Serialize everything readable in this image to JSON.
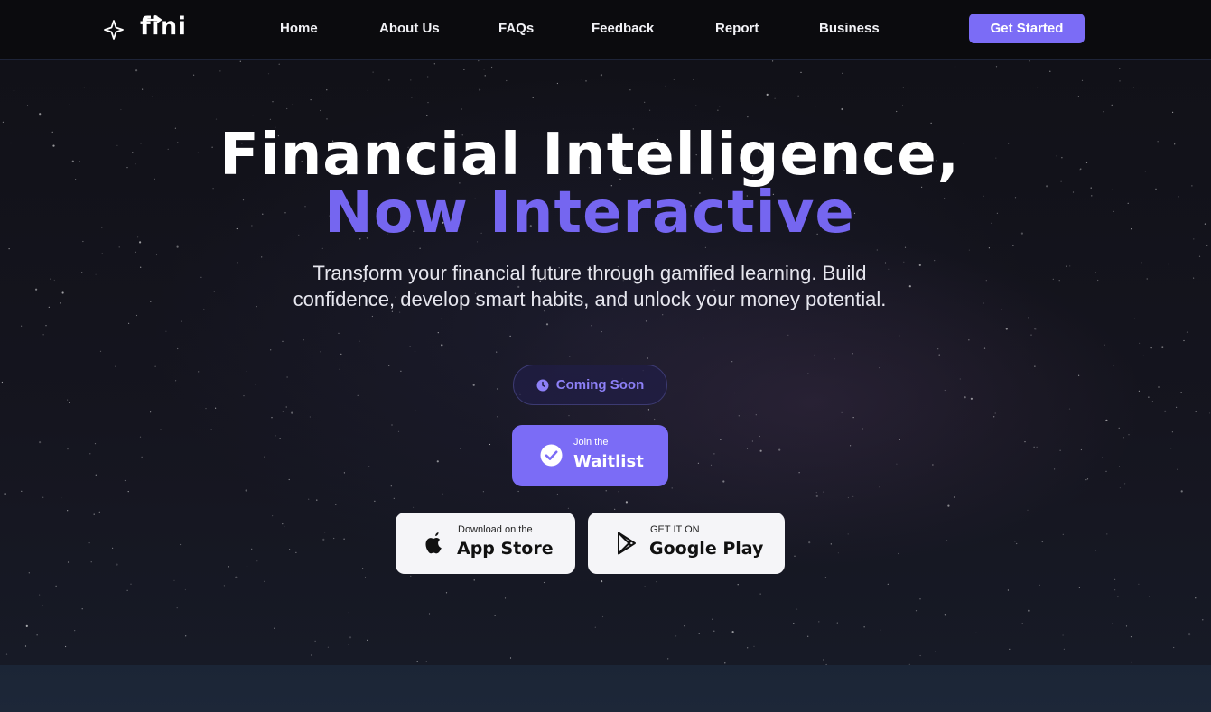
{
  "brand": {
    "name": "fini"
  },
  "nav": {
    "items": [
      {
        "label": "Home"
      },
      {
        "label": "About Us"
      },
      {
        "label": "FAQs"
      },
      {
        "label": "Feedback"
      },
      {
        "label": "Report"
      },
      {
        "label": "Business"
      }
    ],
    "cta_label": "Get Started"
  },
  "hero": {
    "title_line1": "Financial Intelligence,",
    "title_line2": "Now Interactive",
    "subtitle": "Transform your financial future through gamified learning. Build confidence, develop smart habits, and unlock your money potential.",
    "badge_label": "Coming Soon",
    "waitlist": {
      "small": "Join the",
      "big": "Waitlist"
    },
    "app_store": {
      "small": "Download on the",
      "big": "App Store"
    },
    "google_play": {
      "small": "GET IT ON",
      "big": "Google Play"
    }
  },
  "colors": {
    "accent": "#7b6cf6",
    "accent_text": "#7566f0",
    "background": "#111118",
    "header": "#0b0b0e"
  },
  "icons": [
    "sparkle-icon",
    "clock-icon",
    "check-circle-icon",
    "apple-icon",
    "google-play-icon"
  ]
}
